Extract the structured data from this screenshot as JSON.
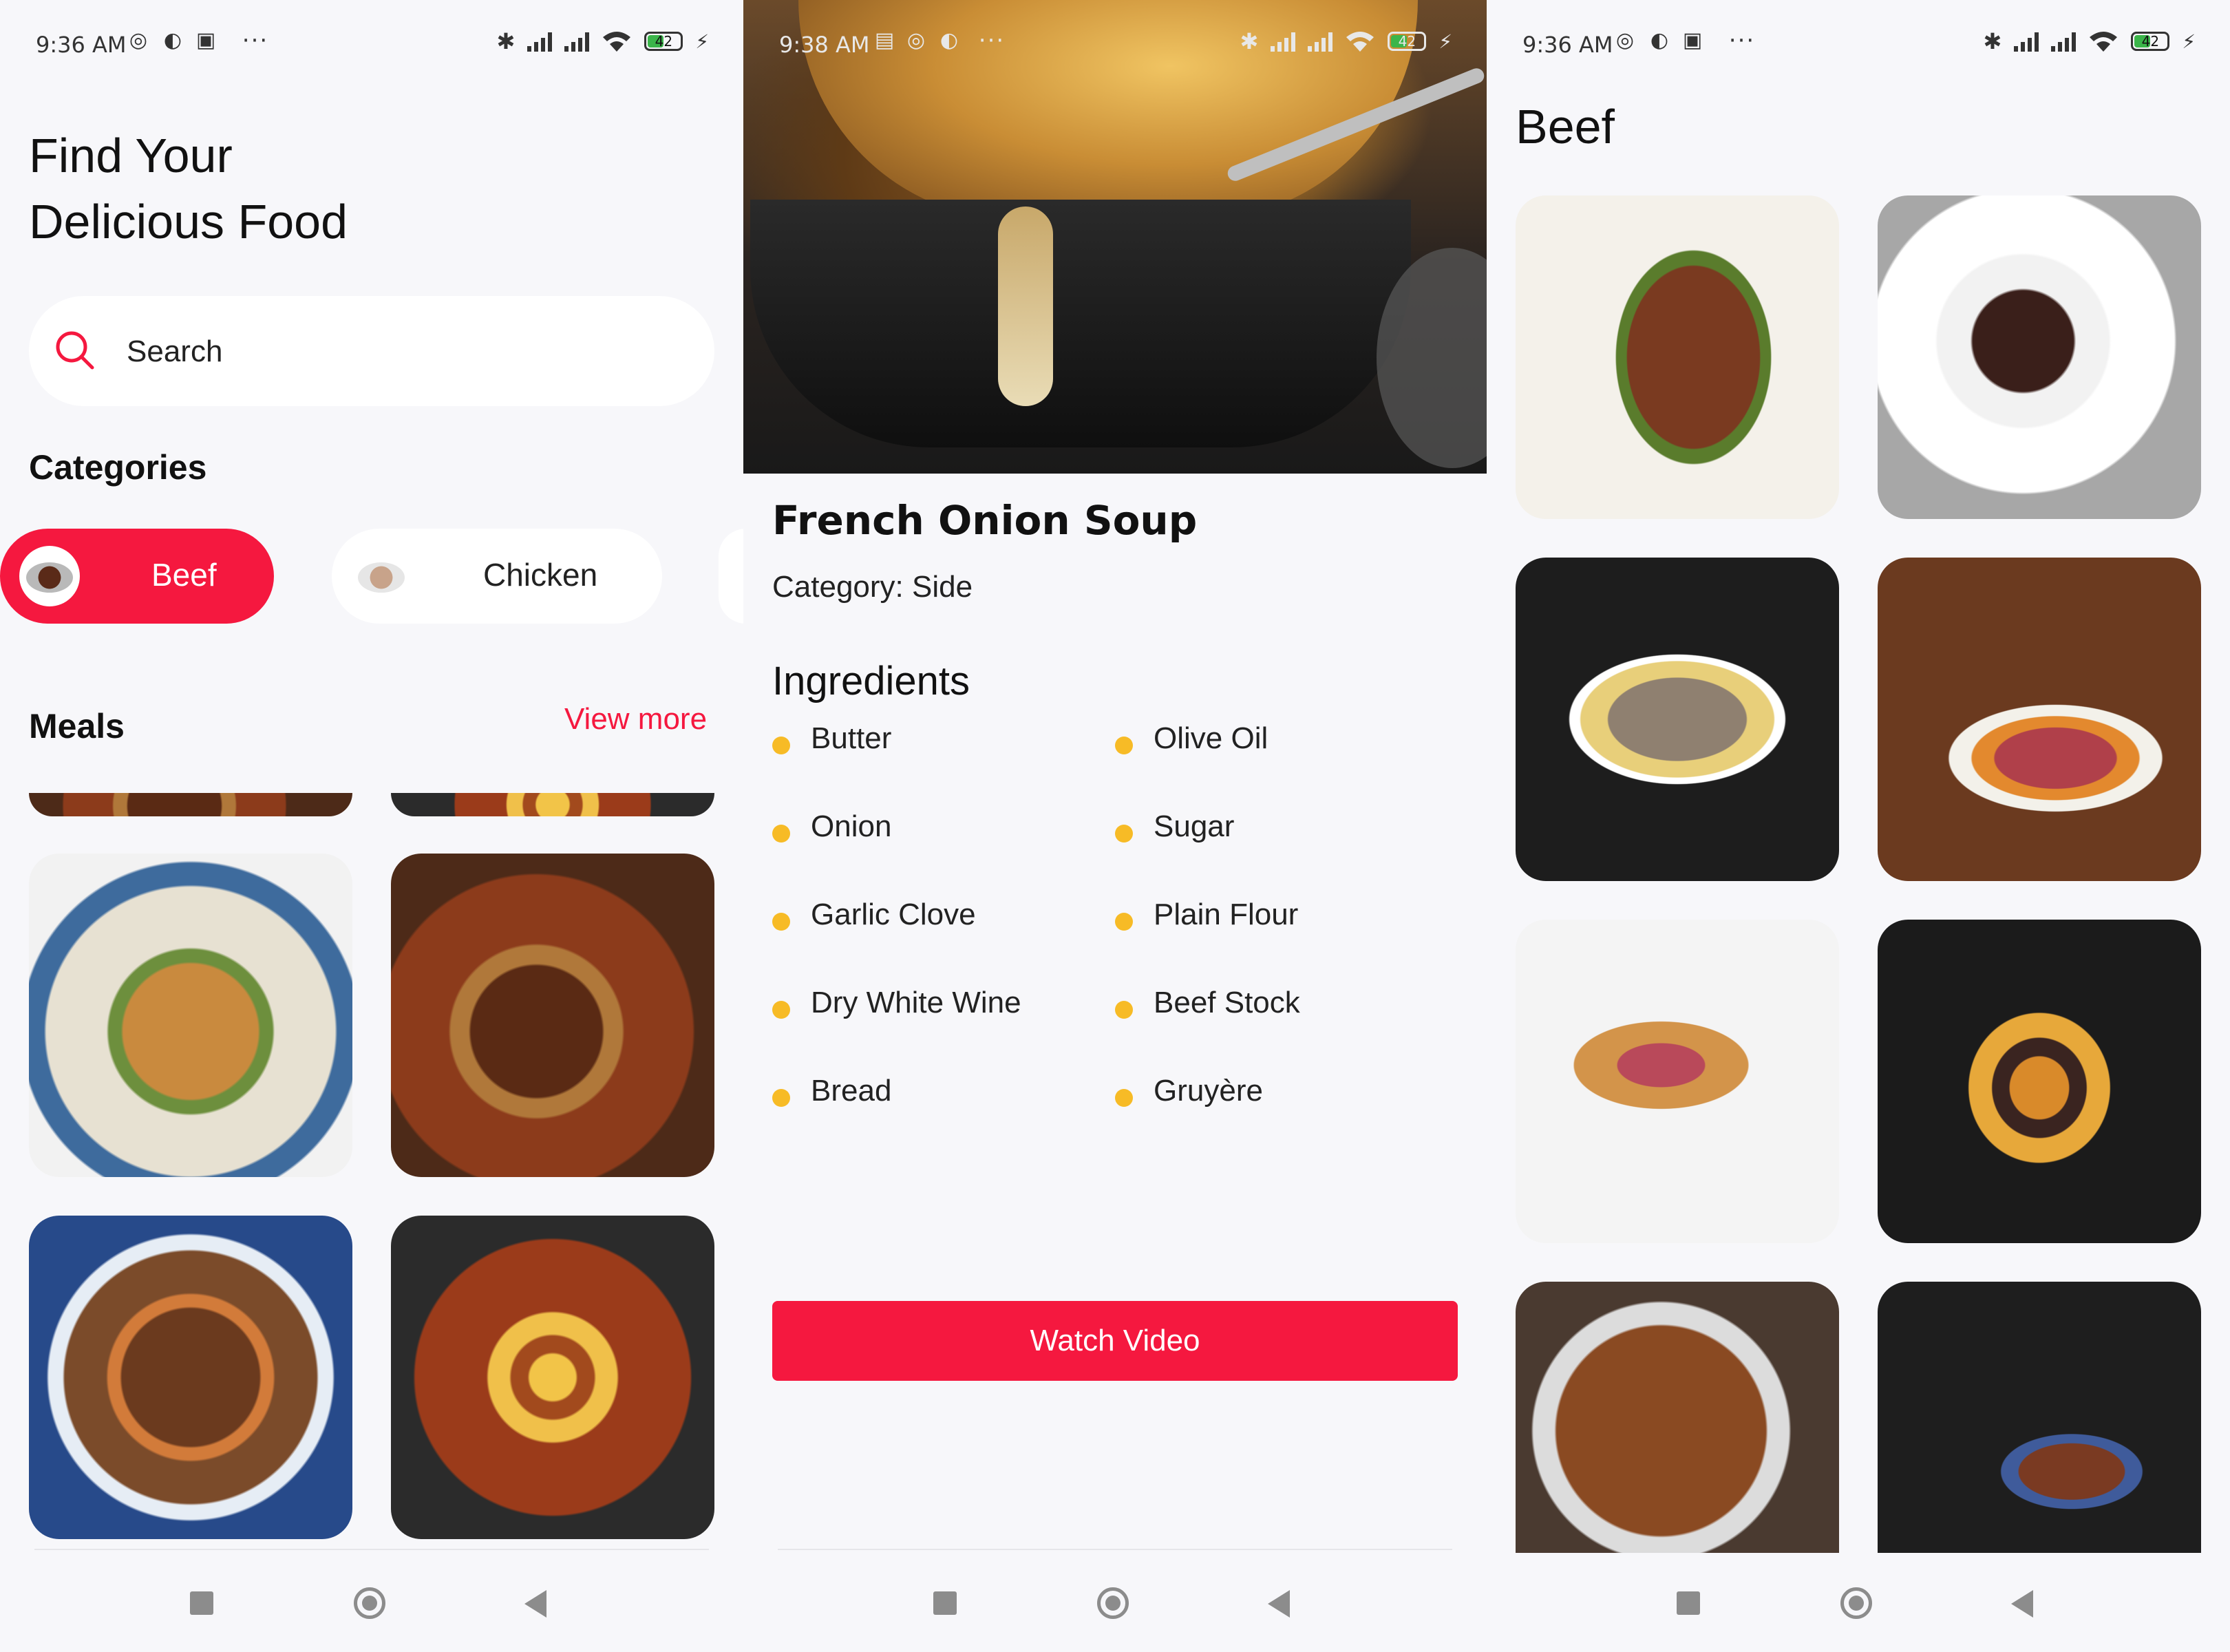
{
  "screens": [
    {
      "status": {
        "time": "9:36 AM",
        "battery": "42"
      },
      "title_line1": "Find Your",
      "title_line2": "Delicious Food",
      "search": {
        "placeholder": "Search"
      },
      "categories_title": "Categories",
      "categories": [
        {
          "label": "Beef"
        },
        {
          "label": "Chicken"
        }
      ],
      "meals_title": "Meals",
      "view_more": "View more"
    },
    {
      "status": {
        "time": "9:38 AM",
        "battery": "42"
      },
      "meal_title": "French Onion Soup",
      "category": "Category: Side",
      "ingredients_title": "Ingredients",
      "ingredients": [
        "Butter",
        "Olive Oil",
        "Onion",
        "Sugar",
        "Garlic Clove",
        "Plain Flour",
        "Dry White Wine",
        "Beef Stock",
        "Bread",
        "Gruyère"
      ],
      "watch_button": "Watch Video"
    },
    {
      "status": {
        "time": "9:36 AM",
        "battery": "42"
      },
      "category_title": "Beef"
    }
  ],
  "colors": {
    "accent": "#f5183f",
    "bullet": "#f7bb26",
    "background": "#f7f7fa"
  }
}
